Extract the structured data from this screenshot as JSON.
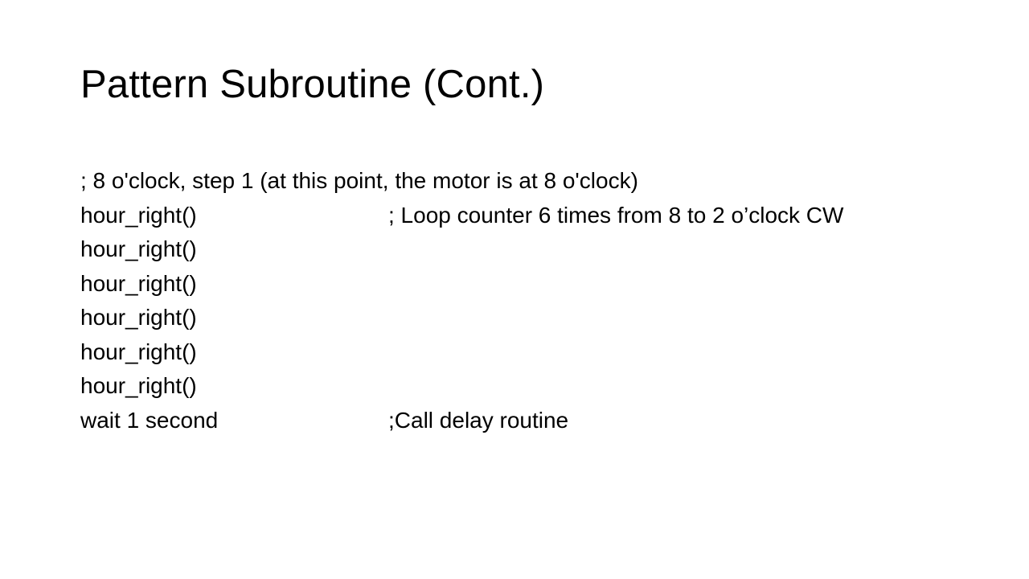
{
  "slide": {
    "title": "Pattern Subroutine (Cont.)",
    "lines": [
      {
        "code": "; 8 o'clock, step 1 (at this point, the motor is at 8 o'clock)",
        "comment": ""
      },
      {
        "code": "hour_right()",
        "comment": "; Loop counter 6 times from 8 to 2 o’clock CW"
      },
      {
        "code": "hour_right()",
        "comment": ""
      },
      {
        "code": "hour_right()",
        "comment": ""
      },
      {
        "code": "hour_right()",
        "comment": ""
      },
      {
        "code": "hour_right()",
        "comment": ""
      },
      {
        "code": "hour_right()",
        "comment": ""
      },
      {
        "code": "wait 1 second",
        "comment": ";Call delay routine"
      }
    ]
  },
  "colors": {
    "background": "#ffffff",
    "text": "#000000"
  }
}
